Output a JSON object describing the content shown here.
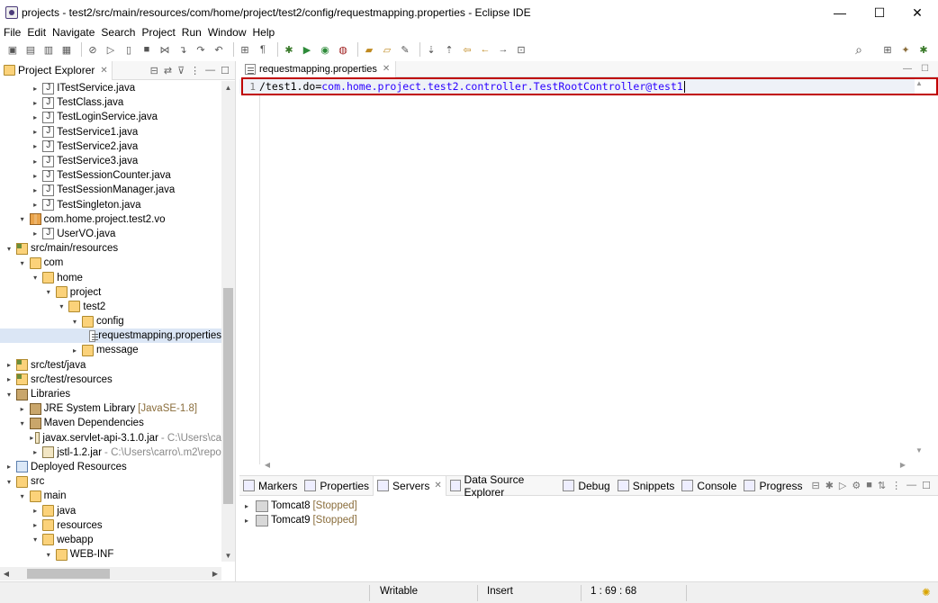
{
  "window": {
    "title": "projects - test2/src/main/resources/com/home/project/test2/config/requestmapping.properties - Eclipse IDE",
    "minimize": "—",
    "maximize": "☐",
    "close": "✕"
  },
  "menu": [
    "File",
    "Edit",
    "Navigate",
    "Search",
    "Project",
    "Run",
    "Window",
    "Help"
  ],
  "explorer": {
    "tab_label": "Project Explorer",
    "tree": [
      {
        "label": "ITestService.java",
        "icon": "java-file",
        "twisty": ">",
        "indent": 2
      },
      {
        "label": "TestClass.java",
        "icon": "java-file",
        "twisty": ">",
        "indent": 2
      },
      {
        "label": "TestLoginService.java",
        "icon": "java-file",
        "twisty": ">",
        "indent": 2
      },
      {
        "label": "TestService1.java",
        "icon": "java-file",
        "twisty": ">",
        "indent": 2
      },
      {
        "label": "TestService2.java",
        "icon": "java-file",
        "twisty": ">",
        "indent": 2
      },
      {
        "label": "TestService3.java",
        "icon": "java-file",
        "twisty": ">",
        "indent": 2
      },
      {
        "label": "TestSessionCounter.java",
        "icon": "java-file",
        "twisty": ">",
        "indent": 2
      },
      {
        "label": "TestSessionManager.java",
        "icon": "java-file",
        "twisty": ">",
        "indent": 2
      },
      {
        "label": "TestSingleton.java",
        "icon": "java-file",
        "twisty": ">",
        "indent": 2
      },
      {
        "label": "com.home.project.test2.vo",
        "icon": "package",
        "twisty": "v",
        "indent": 1
      },
      {
        "label": "UserVO.java",
        "icon": "java-file",
        "twisty": ">",
        "indent": 2
      },
      {
        "label": "src/main/resources",
        "icon": "source-folder",
        "twisty": "v",
        "indent": 0
      },
      {
        "label": "com",
        "icon": "folder",
        "twisty": "v",
        "indent": 1
      },
      {
        "label": "home",
        "icon": "folder",
        "twisty": "v",
        "indent": 2
      },
      {
        "label": "project",
        "icon": "folder",
        "twisty": "v",
        "indent": 3
      },
      {
        "label": "test2",
        "icon": "folder",
        "twisty": "v",
        "indent": 4
      },
      {
        "label": "config",
        "icon": "folder",
        "twisty": "v",
        "indent": 5
      },
      {
        "label": "requestmapping.properties",
        "icon": "properties-file",
        "twisty": "",
        "indent": 6,
        "selected": true
      },
      {
        "label": "message",
        "icon": "folder",
        "twisty": ">",
        "indent": 5
      },
      {
        "label": "src/test/java",
        "icon": "source-folder",
        "twisty": ">",
        "indent": 0
      },
      {
        "label": "src/test/resources",
        "icon": "source-folder",
        "twisty": ">",
        "indent": 0
      },
      {
        "label": "Libraries",
        "icon": "library",
        "twisty": "v",
        "indent": 0
      },
      {
        "label": "JRE System Library",
        "deco": "[JavaSE-1.8]",
        "icon": "library",
        "twisty": ">",
        "indent": 1
      },
      {
        "label": "Maven Dependencies",
        "icon": "library",
        "twisty": "v",
        "indent": 1
      },
      {
        "label": "javax.servlet-api-3.1.0.jar",
        "muted": "- C:\\Users\\ca",
        "icon": "jar",
        "twisty": ">",
        "indent": 2
      },
      {
        "label": "jstl-1.2.jar",
        "muted": "- C:\\Users\\carro\\.m2\\repo",
        "icon": "jar",
        "twisty": ">",
        "indent": 2
      },
      {
        "label": "Deployed Resources",
        "icon": "deployed-resources",
        "twisty": ">",
        "indent": 0
      },
      {
        "label": "src",
        "icon": "folder",
        "twisty": "v",
        "indent": 0
      },
      {
        "label": "main",
        "icon": "folder",
        "twisty": "v",
        "indent": 1
      },
      {
        "label": "java",
        "icon": "folder",
        "twisty": ">",
        "indent": 2
      },
      {
        "label": "resources",
        "icon": "folder",
        "twisty": ">",
        "indent": 2
      },
      {
        "label": "webapp",
        "icon": "folder",
        "twisty": "v",
        "indent": 2
      },
      {
        "label": "WEB-INF",
        "icon": "folder",
        "twisty": "v",
        "indent": 3
      }
    ]
  },
  "editor": {
    "tab_label": "requestmapping.properties",
    "lines": [
      {
        "number": "1",
        "key": "/test1.do",
        "sep": "=",
        "value": "com.home.project.test2.controller.TestRootController@test1"
      }
    ]
  },
  "views": {
    "tabs": [
      {
        "label": "Markers",
        "icon": "markers-icon"
      },
      {
        "label": "Properties",
        "icon": "properties-view-icon"
      },
      {
        "label": "Servers",
        "icon": "servers-icon",
        "active": true
      },
      {
        "label": "Data Source Explorer",
        "icon": "data-source-icon"
      },
      {
        "label": "Debug",
        "icon": "debug-icon"
      },
      {
        "label": "Snippets",
        "icon": "snippets-icon"
      },
      {
        "label": "Console",
        "icon": "console-icon"
      },
      {
        "label": "Progress",
        "icon": "progress-icon"
      }
    ],
    "servers": [
      {
        "name": "Tomcat8",
        "state": "[Stopped]"
      },
      {
        "name": "Tomcat9",
        "state": "[Stopped]"
      }
    ]
  },
  "status": {
    "mode": "Writable",
    "insert": "Insert",
    "position": "1 : 69 : 68"
  }
}
